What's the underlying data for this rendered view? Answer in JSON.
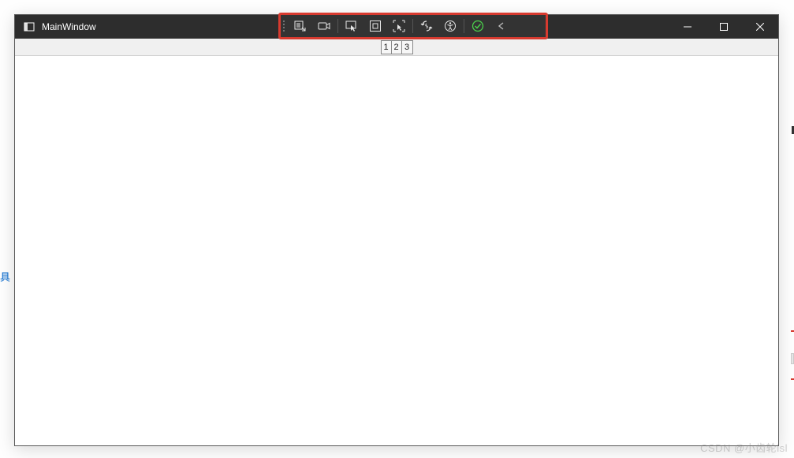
{
  "window": {
    "title": "MainWindow"
  },
  "debug_toolbar": {
    "buttons": [
      {
        "name": "live-visual-tree-icon"
      },
      {
        "name": "camera-icon"
      },
      {
        "name": "select-element-icon"
      },
      {
        "name": "display-layout-adorners-icon"
      },
      {
        "name": "track-focused-element-icon"
      },
      {
        "name": "hot-reload-icon"
      },
      {
        "name": "accessibility-icon"
      },
      {
        "name": "status-ok-icon"
      },
      {
        "name": "collapse-icon"
      }
    ]
  },
  "header_cells": [
    "1",
    "2",
    "3"
  ],
  "side_text": "具",
  "watermark": "CSDN @小齿轮lsl"
}
